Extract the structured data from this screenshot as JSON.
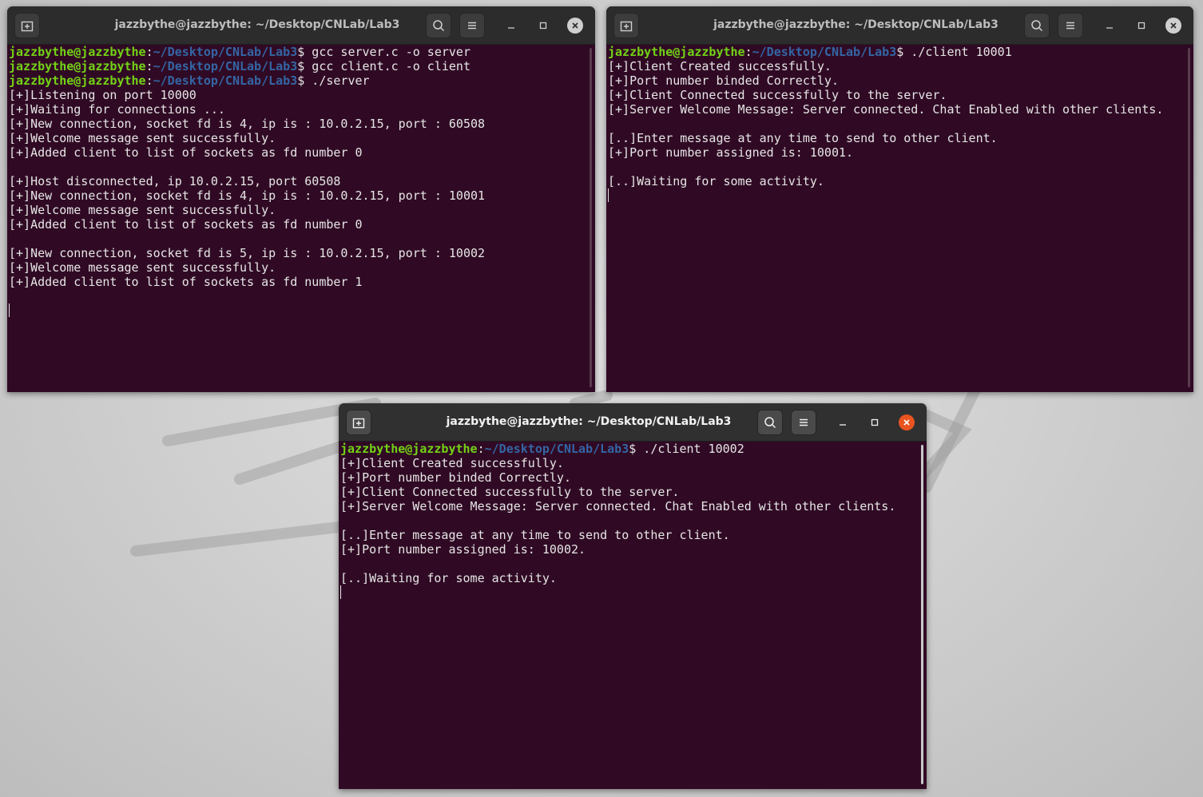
{
  "colors": {
    "terminal_bg": "#300a24",
    "prompt_user": "#73d216",
    "prompt_path": "#3465a4",
    "text": "#e6e6e6",
    "close_active": "#e95420"
  },
  "icons": {
    "new_tab": "new-tab-icon",
    "search": "search-icon",
    "menu": "hamburger-menu-icon",
    "minimize": "minimize-icon",
    "maximize": "maximize-icon",
    "close": "close-icon"
  },
  "windows": {
    "server": {
      "title": "jazzbythe@jazzbythe: ~/Desktop/CNLab/Lab3",
      "lines": [
        {
          "user": "jazzbythe@jazzbythe",
          "sep": ":",
          "path": "~/Desktop/CNLab/Lab3",
          "cmd": "$ gcc server.c -o server"
        },
        {
          "user": "jazzbythe@jazzbythe",
          "sep": ":",
          "path": "~/Desktop/CNLab/Lab3",
          "cmd": "$ gcc client.c -o client"
        },
        {
          "user": "jazzbythe@jazzbythe",
          "sep": ":",
          "path": "~/Desktop/CNLab/Lab3",
          "cmd": "$ ./server"
        },
        {
          "text": "[+]Listening on port 10000"
        },
        {
          "text": "[+]Waiting for connections ..."
        },
        {
          "text": "[+]New connection, socket fd is 4, ip is : 10.0.2.15, port : 60508"
        },
        {
          "text": "[+]Welcome message sent successfully."
        },
        {
          "text": "[+]Added client to list of sockets as fd number 0"
        },
        {
          "text": ""
        },
        {
          "text": "[+]Host disconnected, ip 10.0.2.15, port 60508"
        },
        {
          "text": "[+]New connection, socket fd is 4, ip is : 10.0.2.15, port : 10001"
        },
        {
          "text": "[+]Welcome message sent successfully."
        },
        {
          "text": "[+]Added client to list of sockets as fd number 0"
        },
        {
          "text": ""
        },
        {
          "text": "[+]New connection, socket fd is 5, ip is : 10.0.2.15, port : 10002"
        },
        {
          "text": "[+]Welcome message sent successfully."
        },
        {
          "text": "[+]Added client to list of sockets as fd number 1"
        },
        {
          "text": ""
        },
        {
          "cursor": true
        }
      ]
    },
    "client1": {
      "title": "jazzbythe@jazzbythe: ~/Desktop/CNLab/Lab3",
      "lines": [
        {
          "user": "jazzbythe@jazzbythe",
          "sep": ":",
          "path": "~/Desktop/CNLab/Lab3",
          "cmd": "$ ./client 10001"
        },
        {
          "text": "[+]Client Created successfully."
        },
        {
          "text": "[+]Port number binded Correctly."
        },
        {
          "text": "[+]Client Connected successfully to the server."
        },
        {
          "text": "[+]Server Welcome Message: Server connected. Chat Enabled with other clients."
        },
        {
          "text": ""
        },
        {
          "text": "[..]Enter message at any time to send to other client."
        },
        {
          "text": "[+]Port number assigned is: 10001."
        },
        {
          "text": ""
        },
        {
          "text": "[..]Waiting for some activity."
        },
        {
          "cursor": true
        }
      ]
    },
    "client2": {
      "title": "jazzbythe@jazzbythe: ~/Desktop/CNLab/Lab3",
      "lines": [
        {
          "user": "jazzbythe@jazzbythe",
          "sep": ":",
          "path": "~/Desktop/CNLab/Lab3",
          "cmd": "$ ./client 10002"
        },
        {
          "text": "[+]Client Created successfully."
        },
        {
          "text": "[+]Port number binded Correctly."
        },
        {
          "text": "[+]Client Connected successfully to the server."
        },
        {
          "text": "[+]Server Welcome Message: Server connected. Chat Enabled with other clients."
        },
        {
          "text": ""
        },
        {
          "text": "[..]Enter message at any time to send to other client."
        },
        {
          "text": "[+]Port number assigned is: 10002."
        },
        {
          "text": ""
        },
        {
          "text": "[..]Waiting for some activity."
        },
        {
          "cursor": true
        }
      ]
    }
  }
}
